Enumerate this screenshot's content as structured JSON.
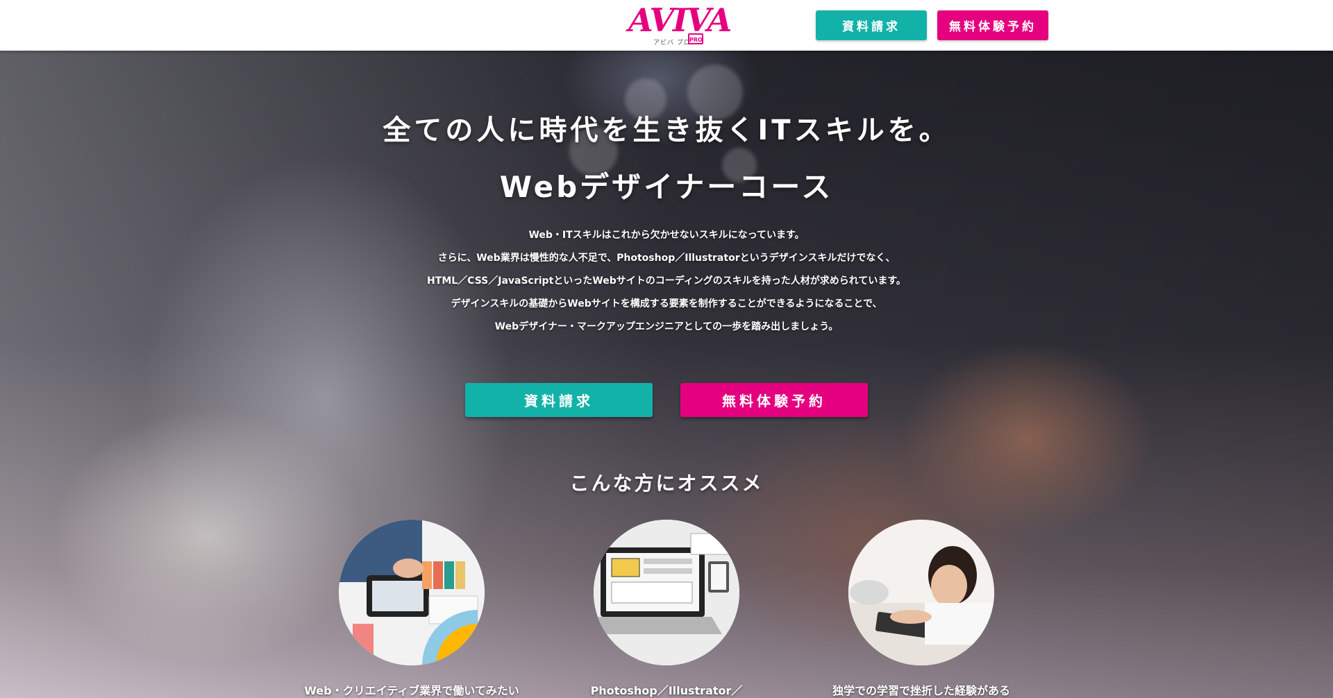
{
  "header": {
    "logo_text": "AVIVA",
    "logo_sub": "アビバ プロ",
    "logo_pro": "PRO",
    "btn_request": "資料請求",
    "btn_trial": "無料体験予約"
  },
  "hero": {
    "tagline": "全ての人に時代を生き抜くITスキルを。",
    "course": "Webデザイナーコース",
    "description": [
      "Web・ITスキルはこれから欠かせないスキルになっています。",
      "さらに、Web業界は慢性的な人不足で、Photoshop／Illustratorというデザインスキルだけでなく、",
      "HTML／CSS／JavaScriptといったWebサイトのコーディングのスキルを持った人材が求められています。",
      "デザインスキルの基礎からWebサイトを構成する要素を制作することができるようになることで、",
      "Webデザイナー・マークアップエンジニアとしての一歩を踏み出しましょう。"
    ],
    "cta_request": "資料請求",
    "cta_trial": "無料体験予約"
  },
  "recommend": {
    "title": "こんな方にオススメ",
    "items": [
      {
        "caption": "Web・クリエイティブ業界で働いてみたい",
        "image": "designer-color-swatches-photo"
      },
      {
        "caption": "Photoshop／Illustrator／",
        "image": "laptop-wireframe-photo"
      },
      {
        "caption": "独学での学習で挫折した経験がある",
        "image": "tired-woman-keyboard-photo"
      }
    ]
  },
  "colors": {
    "teal": "#13b2a8",
    "pink": "#e5007f"
  }
}
